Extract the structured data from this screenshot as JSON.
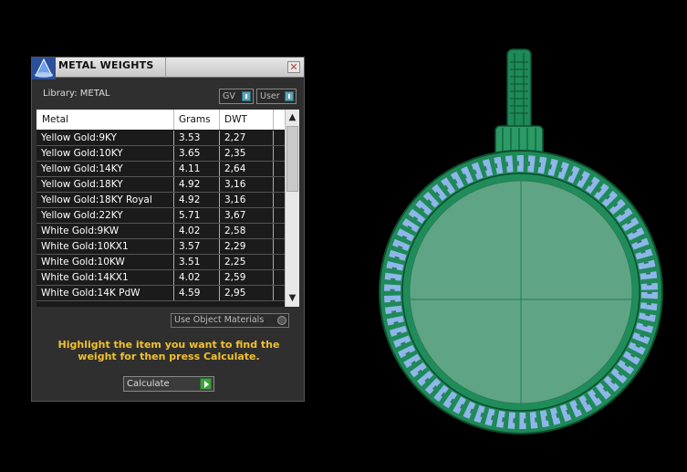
{
  "panel": {
    "title": "METAL WEIGHTS",
    "library_label": "Library: METAL",
    "toggles": [
      {
        "label": "GV"
      },
      {
        "label": "User"
      }
    ],
    "columns": [
      "Metal",
      "Grams",
      "DWT"
    ],
    "rows": [
      {
        "metal": "Yellow Gold:9KY",
        "grams": "3.53",
        "dwt": "2,27"
      },
      {
        "metal": "Yellow Gold:10KY",
        "grams": "3.65",
        "dwt": "2,35"
      },
      {
        "metal": "Yellow Gold:14KY",
        "grams": "4.11",
        "dwt": "2,64"
      },
      {
        "metal": "Yellow Gold:18KY",
        "grams": "4.92",
        "dwt": "3,16"
      },
      {
        "metal": "Yellow Gold:18KY Royal",
        "grams": "4.92",
        "dwt": "3,16"
      },
      {
        "metal": "Yellow Gold:22KY",
        "grams": "5.71",
        "dwt": "3,67"
      },
      {
        "metal": "White Gold:9KW",
        "grams": "4.02",
        "dwt": "2,58"
      },
      {
        "metal": "White Gold:10KX1",
        "grams": "3.57",
        "dwt": "2,29"
      },
      {
        "metal": "White Gold:10KW",
        "grams": "3.51",
        "dwt": "2,25"
      },
      {
        "metal": "White Gold:14KX1",
        "grams": "4.02",
        "dwt": "2,59"
      },
      {
        "metal": "White Gold:14K PdW",
        "grams": "4.59",
        "dwt": "2,95"
      }
    ],
    "use_object_label": "Use Object Materials",
    "hint": "Highlight the item you want to find the weight for then press Calculate.",
    "calculate_label": "Calculate",
    "close_symbol": "✕",
    "scroll_up": "▲",
    "scroll_down": "▼"
  },
  "colors": {
    "hint": "#f2c12e",
    "pendant_fill": "#5fa585",
    "pendant_rim": "#1e8a57",
    "stones": "#8fb6ea"
  },
  "icons": [
    "app-logo-icon",
    "close-icon",
    "toggle-switch-icon",
    "radio-icon",
    "play-icon",
    "scroll-up-icon",
    "scroll-down-icon"
  ]
}
